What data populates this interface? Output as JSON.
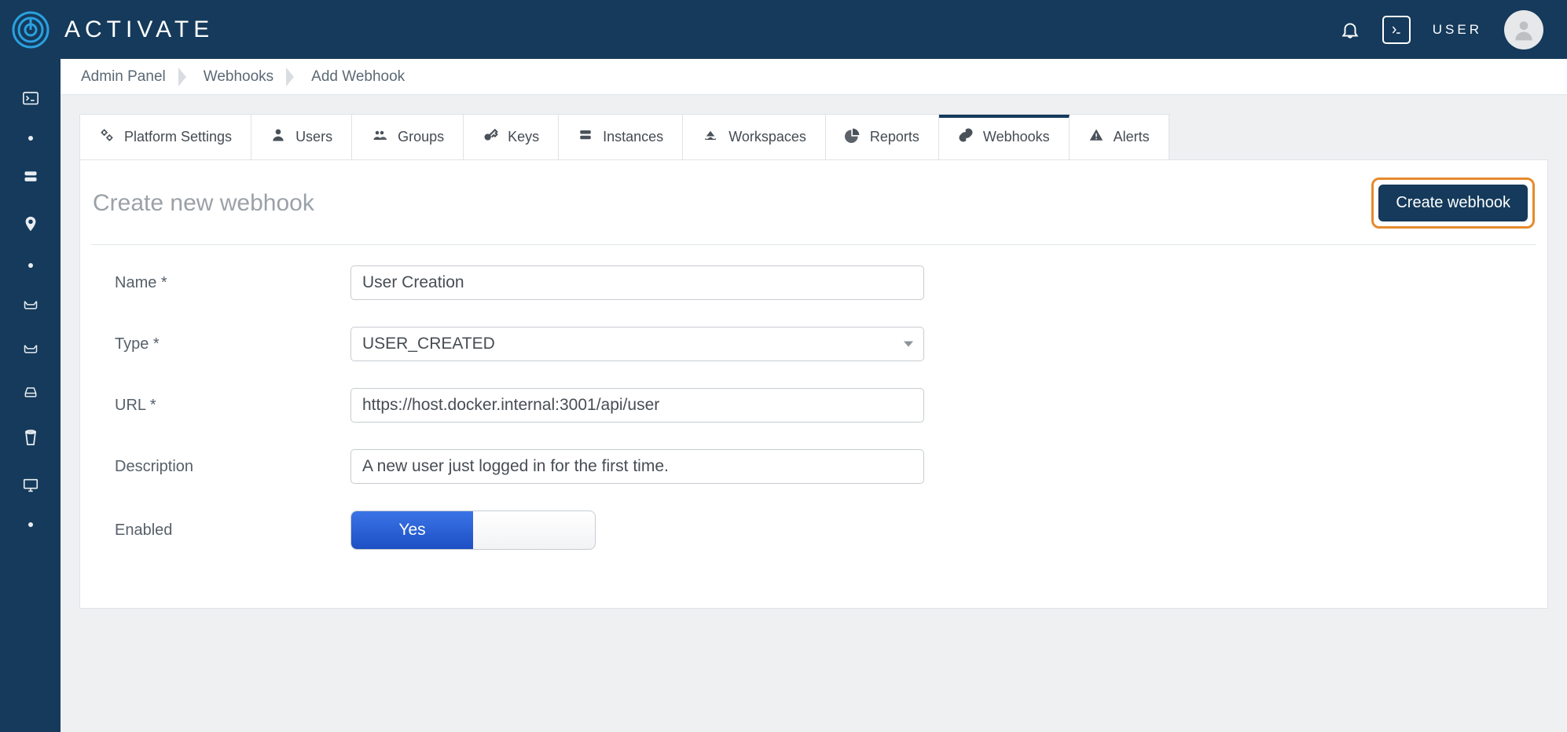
{
  "brand": {
    "name": "ACTIVATE"
  },
  "header": {
    "user_label": "USER"
  },
  "breadcrumbs": [
    "Admin Panel",
    "Webhooks",
    "Add Webhook"
  ],
  "tabs": [
    {
      "label": "Platform Settings",
      "icon": "gears-icon"
    },
    {
      "label": "Users",
      "icon": "user-icon"
    },
    {
      "label": "Groups",
      "icon": "group-icon"
    },
    {
      "label": "Keys",
      "icon": "key-icon"
    },
    {
      "label": "Instances",
      "icon": "server-icon"
    },
    {
      "label": "Workspaces",
      "icon": "ship-icon"
    },
    {
      "label": "Reports",
      "icon": "pie-icon"
    },
    {
      "label": "Webhooks",
      "icon": "link-icon",
      "active": true
    },
    {
      "label": "Alerts",
      "icon": "alert-icon"
    }
  ],
  "form": {
    "title": "Create new webhook",
    "submit_label": "Create webhook",
    "labels": {
      "name": "Name *",
      "type": "Type *",
      "url": "URL *",
      "description": "Description",
      "enabled": "Enabled"
    },
    "values": {
      "name": "User Creation",
      "type": "USER_CREATED",
      "url": "https://host.docker.internal:3001/api/user",
      "description": "A new user just logged in for the first time.",
      "enabled_yes": "Yes",
      "enabled_no": ""
    }
  }
}
